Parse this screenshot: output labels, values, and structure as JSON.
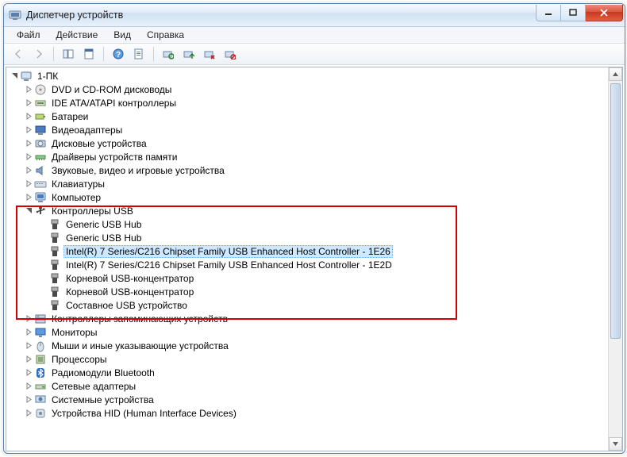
{
  "window": {
    "title": "Диспетчер устройств"
  },
  "menu": {
    "file": "Файл",
    "action": "Действие",
    "view": "Вид",
    "help": "Справка"
  },
  "tree": {
    "root": "1-ПК",
    "categories": [
      {
        "label": "DVD и CD-ROM дисководы",
        "icon": "disc"
      },
      {
        "label": "IDE ATA/ATAPI контроллеры",
        "icon": "ide"
      },
      {
        "label": "Батареи",
        "icon": "battery"
      },
      {
        "label": "Видеоадаптеры",
        "icon": "display"
      },
      {
        "label": "Дисковые устройства",
        "icon": "hdd"
      },
      {
        "label": "Драйверы устройств памяти",
        "icon": "mem"
      },
      {
        "label": "Звуковые, видео и игровые устройства",
        "icon": "sound"
      },
      {
        "label": "Клавиатуры",
        "icon": "keyboard"
      },
      {
        "label": "Компьютер",
        "icon": "computer"
      },
      {
        "label": "Контроллеры USB",
        "icon": "usb",
        "expanded": true,
        "children": [
          "Generic USB Hub",
          "Generic USB Hub",
          "Intel(R) 7 Series/C216 Chipset Family USB Enhanced Host Controller - 1E26",
          "Intel(R) 7 Series/C216 Chipset Family USB Enhanced Host Controller - 1E2D",
          "Корневой USB-концентратор",
          "Корневой USB-концентратор",
          "Составное USB устройство"
        ],
        "selected_index": 2
      },
      {
        "label": "Контроллеры запоминающих устройств",
        "icon": "storage"
      },
      {
        "label": "Мониторы",
        "icon": "monitor"
      },
      {
        "label": "Мыши и иные указывающие устройства",
        "icon": "mouse"
      },
      {
        "label": "Процессоры",
        "icon": "cpu"
      },
      {
        "label": "Радиомодули Bluetooth",
        "icon": "bluetooth"
      },
      {
        "label": "Сетевые адаптеры",
        "icon": "network"
      },
      {
        "label": "Системные устройства",
        "icon": "system"
      },
      {
        "label": "Устройства HID (Human Interface Devices)",
        "icon": "hid"
      }
    ]
  }
}
